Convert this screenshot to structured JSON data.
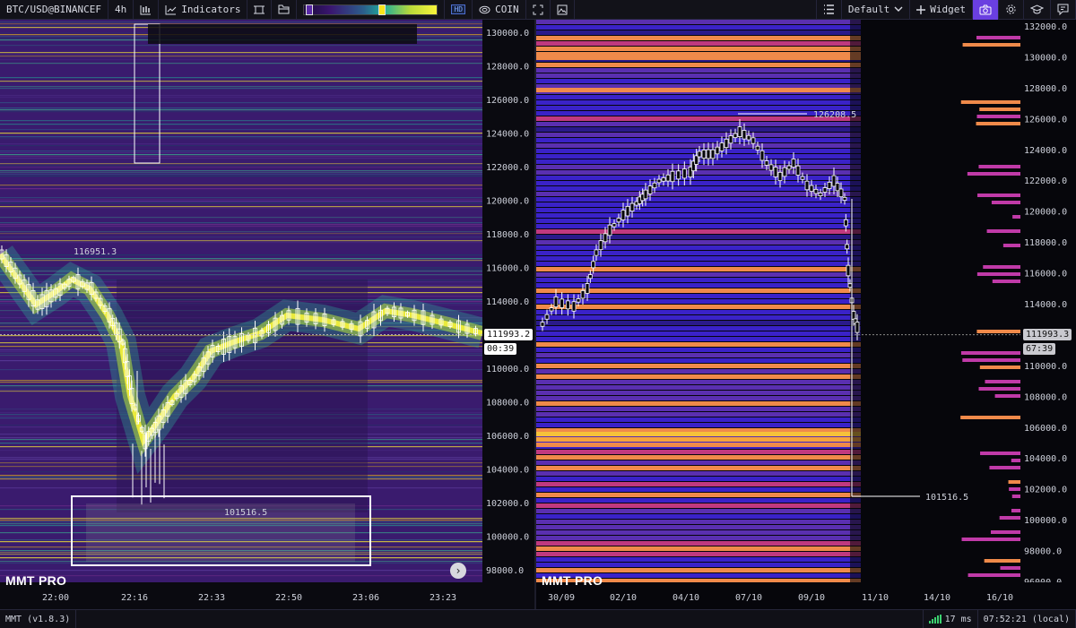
{
  "toolbar": {
    "symbol": "BTC/USD@BINANCEF",
    "timeframe": "4h",
    "indicators_label": "Indicators",
    "hd_badge": "HD",
    "coin_label": "COIN",
    "layout_name": "Default",
    "widget_label": "Widget",
    "icons": [
      "bar-chart-icon",
      "indicators-icon",
      "crop-icon",
      "folder-icon",
      "coin-icon",
      "fullscreen-icon",
      "image-icon",
      "list-icon",
      "chevron-down-icon",
      "plus-icon",
      "camera-icon",
      "gear-icon",
      "graduation-icon",
      "chat-icon"
    ]
  },
  "left_chart": {
    "logo": "MMT PRO",
    "price_axis": [
      "130000.0",
      "128000.0",
      "126000.0",
      "124000.0",
      "122000.0",
      "120000.0",
      "118000.0",
      "116000.0",
      "114000.0",
      "112000.0",
      "110000.0",
      "108000.0",
      "106000.0",
      "104000.0",
      "102000.0",
      "100000.0",
      "98000.0"
    ],
    "time_axis": [
      "22:00",
      "22:16",
      "22:33",
      "22:50",
      "23:06",
      "23:23"
    ],
    "current_price": "111993.2",
    "countdown": "00:39",
    "annotation_high": "116951.3",
    "annotation_low": "101516.5",
    "colors": {
      "heatmap_bg": "#3a1b6e",
      "liquidity_bright": "#f4f23a",
      "price_line": "#ffffff"
    }
  },
  "right_chart": {
    "logo": "MMT PRO",
    "price_axis": [
      "132000.0",
      "130000.0",
      "128000.0",
      "126000.0",
      "124000.0",
      "122000.0",
      "120000.0",
      "118000.0",
      "116000.0",
      "114000.0",
      "112000.0",
      "110000.0",
      "108000.0",
      "106000.0",
      "104000.0",
      "102000.0",
      "100000.0",
      "98000.0",
      "96000.0"
    ],
    "time_axis": [
      "30/09",
      "02/10",
      "04/10",
      "07/10",
      "09/10",
      "11/10",
      "14/10",
      "16/10"
    ],
    "current_price": "111993.3",
    "countdown": "67:39",
    "annotation_high": "126208.5",
    "annotation_low": "101516.5",
    "colors": {
      "band_main": "#3a22c8",
      "band_hot": "#f08a4a",
      "band_peak": "#f6c13a",
      "profile": "#c03aa8"
    }
  },
  "statusbar": {
    "version": "MMT (v1.8.3)",
    "latency": "17 ms",
    "clock": "07:52:21 (local)"
  }
}
